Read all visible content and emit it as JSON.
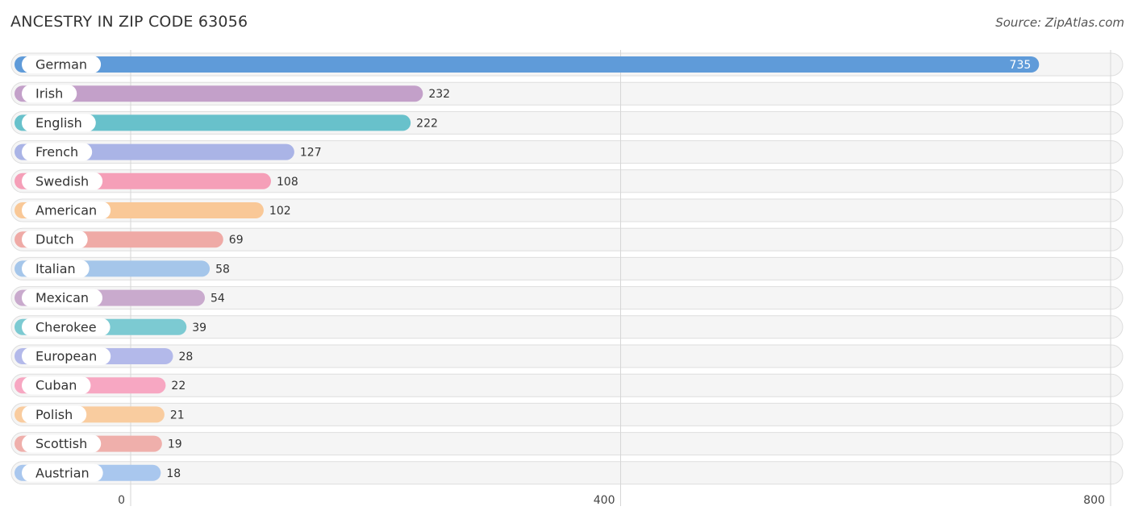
{
  "header": {
    "title": "ANCESTRY IN ZIP CODE 63056",
    "source": "Source: ZipAtlas.com"
  },
  "chart_data": {
    "type": "bar",
    "orientation": "horizontal",
    "title": "ANCESTRY IN ZIP CODE 63056",
    "xlabel": "",
    "ylabel": "",
    "xlim": [
      0,
      800
    ],
    "xticks": [
      0,
      400,
      800
    ],
    "grid": true,
    "categories": [
      "German",
      "Irish",
      "English",
      "French",
      "Swedish",
      "American",
      "Dutch",
      "Italian",
      "Mexican",
      "Cherokee",
      "European",
      "Cuban",
      "Polish",
      "Scottish",
      "Austrian"
    ],
    "values": [
      735,
      232,
      222,
      127,
      108,
      102,
      69,
      58,
      54,
      39,
      28,
      22,
      21,
      19,
      18
    ],
    "colors": [
      "#5f9bd9",
      "#c3a0c9",
      "#68c1cb",
      "#aab4e6",
      "#f59fb8",
      "#f9c897",
      "#efaaa6",
      "#a5c6ea",
      "#c9aacd",
      "#7ccad2",
      "#b3b9ea",
      "#f7a7c2",
      "#f9cc9f",
      "#efafab",
      "#a9c7ee"
    ]
  }
}
